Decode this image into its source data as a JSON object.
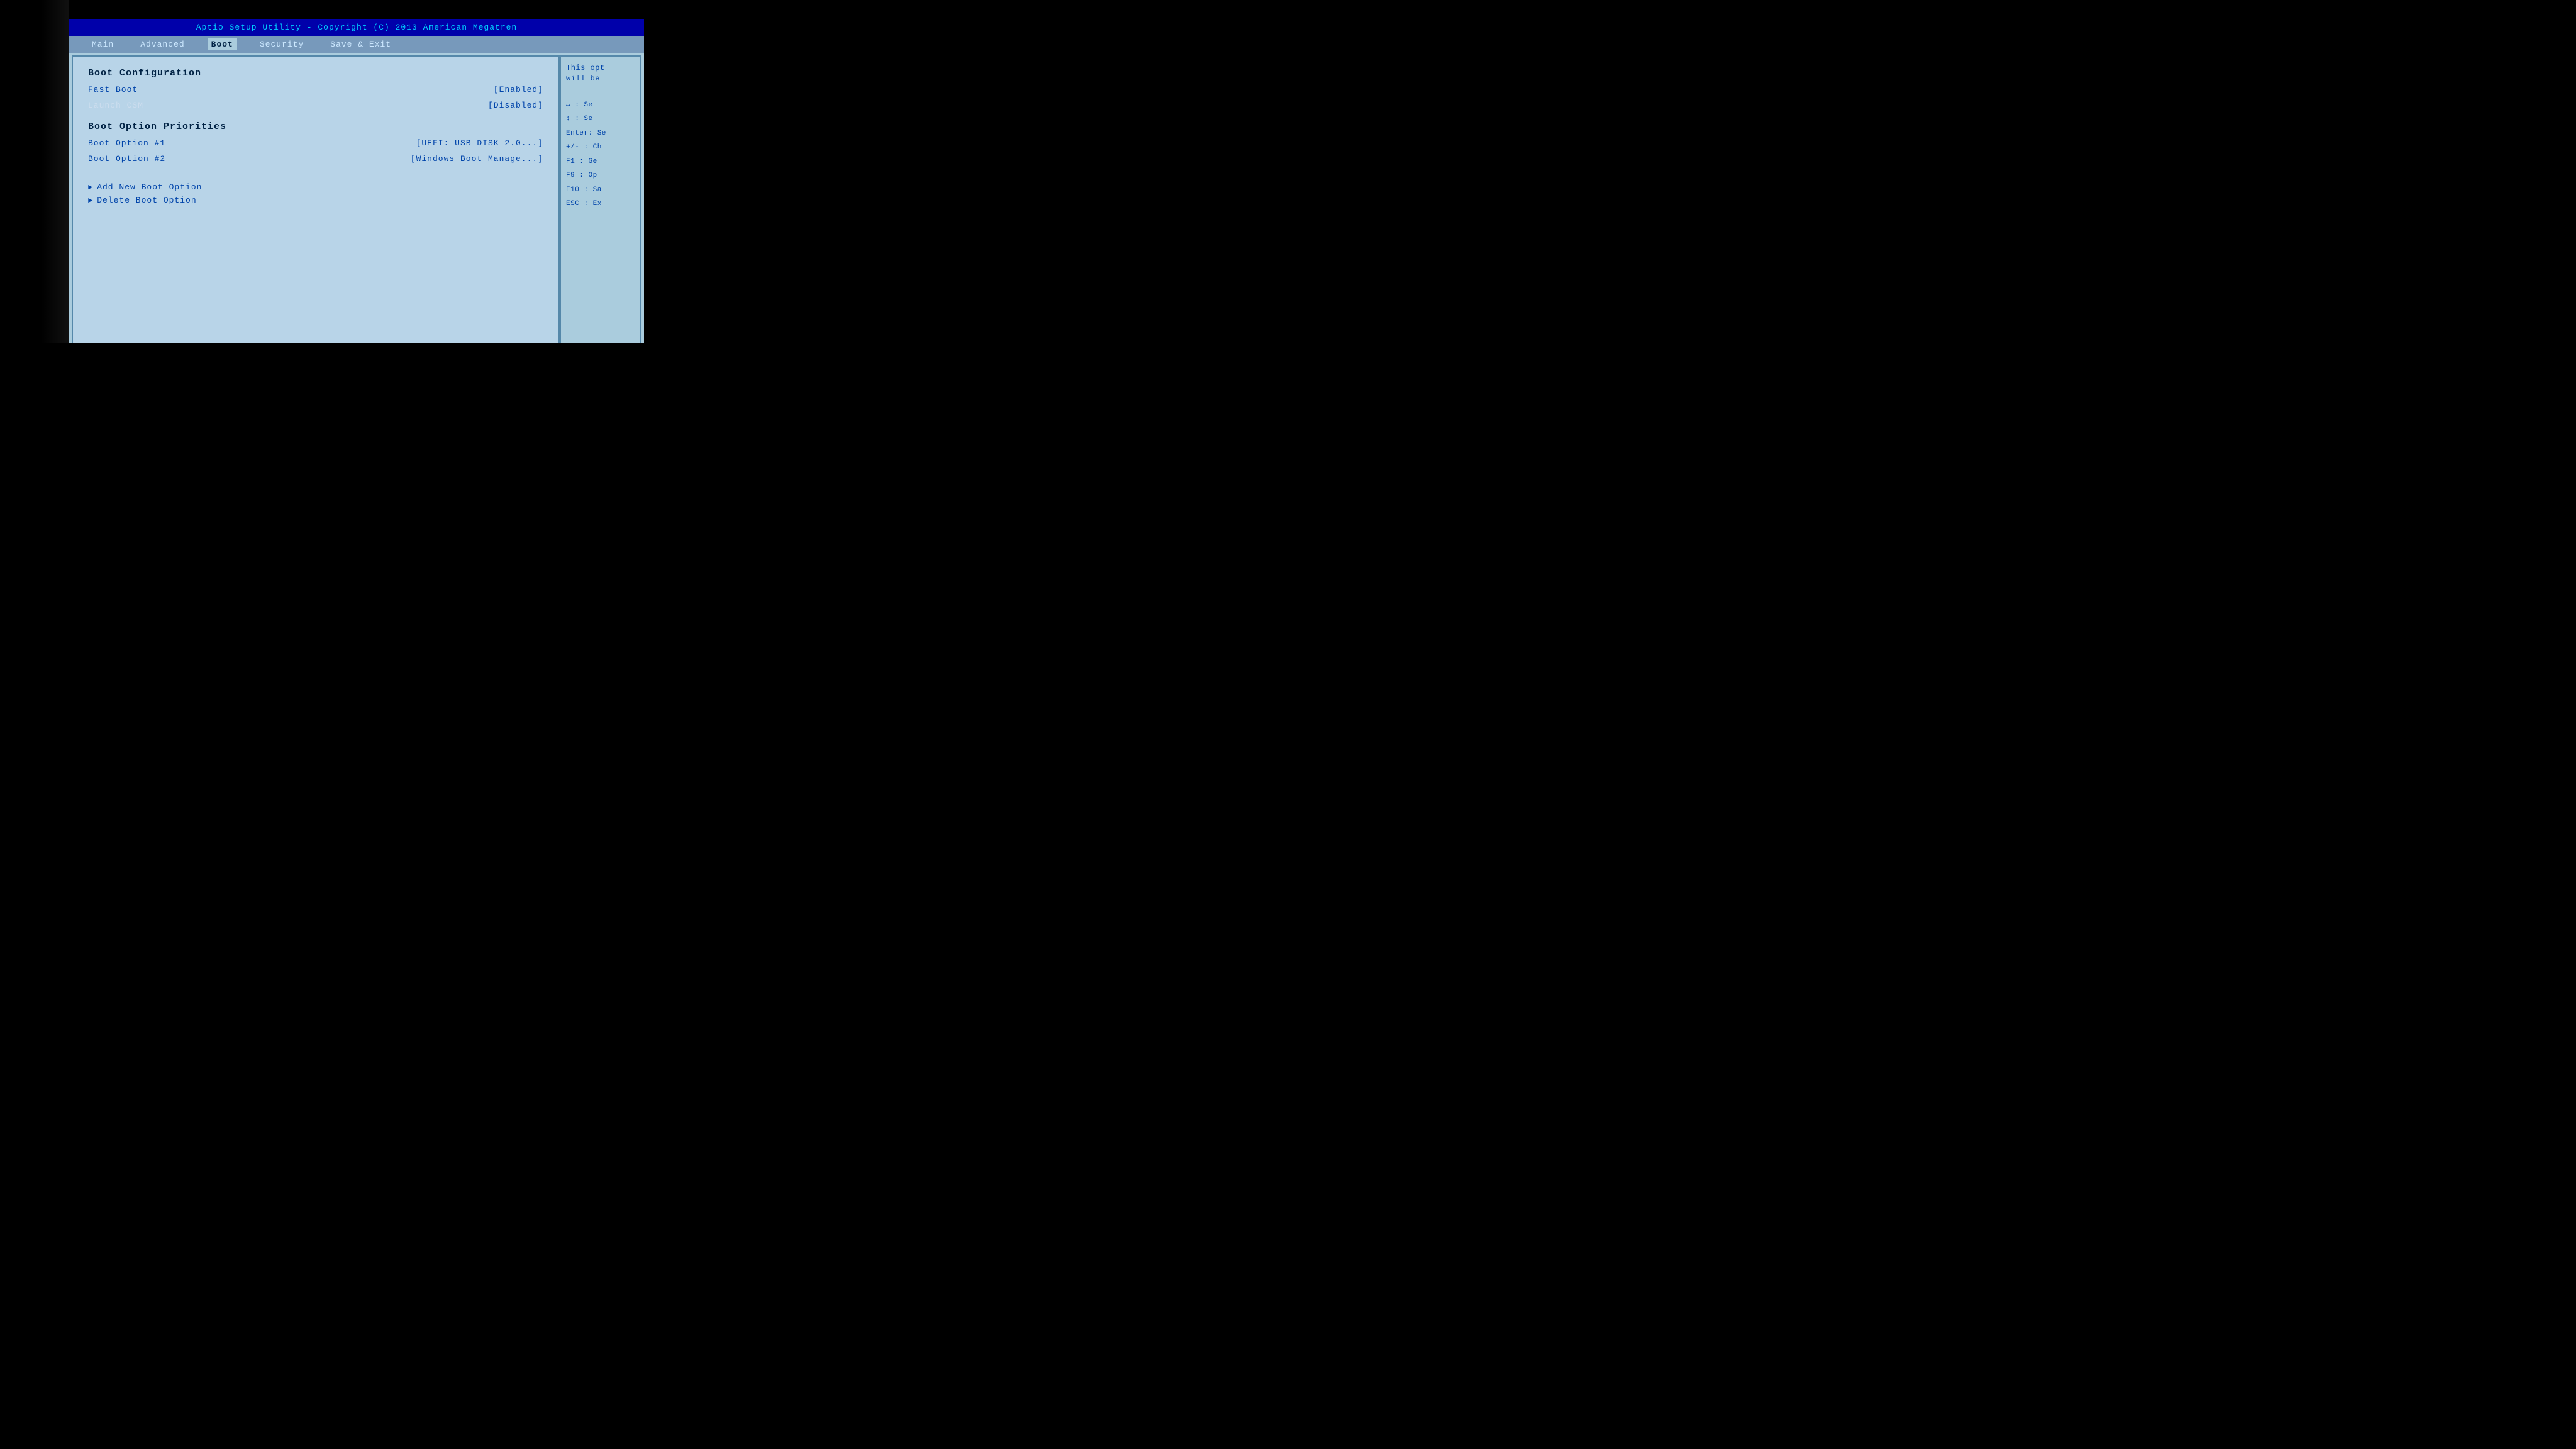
{
  "titleBar": {
    "text": "Aptio Setup Utility - Copyright (C) 2013 American Megatren"
  },
  "navBar": {
    "items": [
      {
        "id": "main",
        "label": "Main",
        "active": false
      },
      {
        "id": "advanced",
        "label": "Advanced",
        "active": false
      },
      {
        "id": "boot",
        "label": "Boot",
        "active": true
      },
      {
        "id": "security",
        "label": "Security",
        "active": false
      },
      {
        "id": "save-exit",
        "label": "Save & Exit",
        "active": false
      }
    ]
  },
  "content": {
    "section1": {
      "title": "Boot Configuration",
      "rows": [
        {
          "label": "Fast Boot",
          "value": "[Enabled]",
          "highlighted": true
        },
        {
          "label": "Launch CSM",
          "value": "[Disabled]",
          "highlighted": false
        }
      ]
    },
    "section2": {
      "title": "Boot Option Priorities",
      "rows": [
        {
          "label": "Boot Option #1",
          "value": "[UEFI:  USB DISK 2.0...]"
        },
        {
          "label": "Boot Option #2",
          "value": "[Windows Boot Manage...]"
        }
      ]
    },
    "submenus": [
      {
        "label": "Add New Boot Option"
      },
      {
        "label": "Delete Boot Option"
      }
    ]
  },
  "helpPanel": {
    "description": "This opt will be",
    "keys": [
      {
        "key": "↔",
        "desc": "Se"
      },
      {
        "key": "↕",
        "desc": "Se"
      },
      {
        "key": "Enter:",
        "desc": "Se"
      },
      {
        "key": "+/-",
        "desc": "Ch"
      },
      {
        "key": "F1",
        "desc": "Ge"
      },
      {
        "key": "F9",
        "desc": "Op"
      },
      {
        "key": "F10",
        "desc": "Sa"
      },
      {
        "key": "ESC",
        "desc": "Ex"
      }
    ]
  }
}
